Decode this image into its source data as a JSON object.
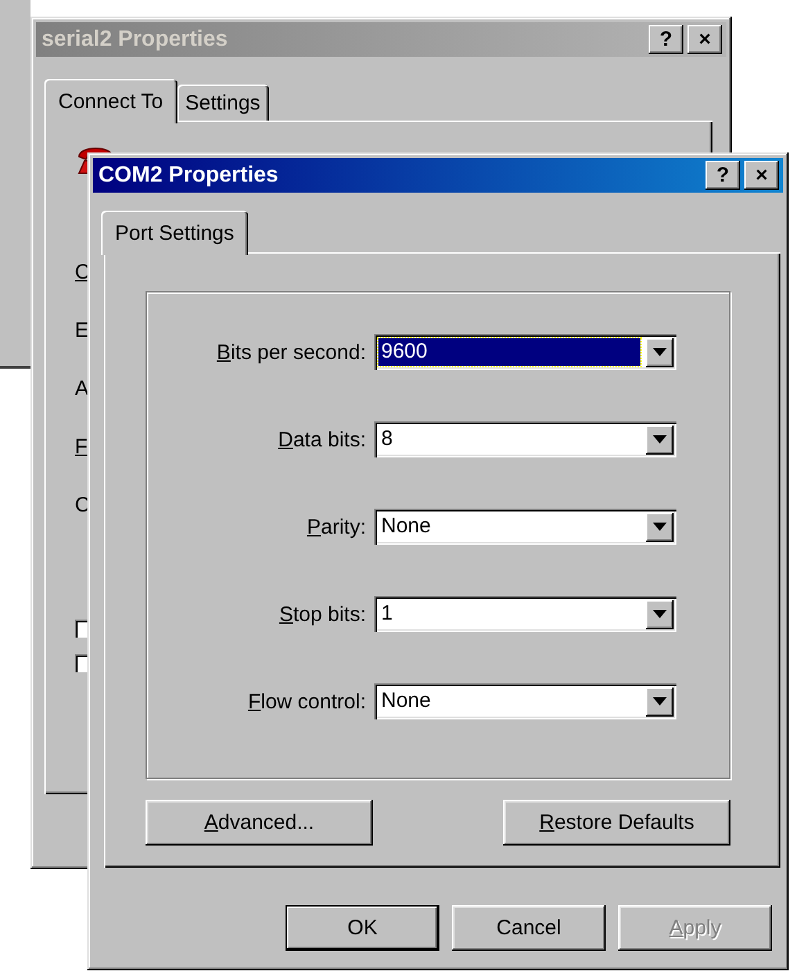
{
  "back_window": {
    "title": "serial2 Properties",
    "title_buttons": [
      "?",
      "×"
    ],
    "tabs": [
      {
        "label": "Connect To",
        "selected": true
      },
      {
        "label": "Settings",
        "selected": false
      }
    ],
    "cut_labels": [
      {
        "text": "C",
        "underlined_key": true
      },
      {
        "text": "E",
        "underlined_key": false
      },
      {
        "text": "A",
        "underlined_key": false
      },
      {
        "text": "F",
        "underlined_key": true
      },
      {
        "text": "C",
        "underlined_key": false
      }
    ],
    "cut_checkboxes": [
      {
        "checked": false
      },
      {
        "checked": false
      }
    ]
  },
  "window": {
    "title": "COM2 Properties",
    "title_buttons": [
      "?",
      "×"
    ],
    "tabs": [
      {
        "label": "Port Settings",
        "selected": true
      }
    ],
    "fields": [
      {
        "label": "Bits per second:",
        "value": "9600",
        "focused": true,
        "underlined_key": true
      },
      {
        "label": "Data bits:",
        "value": "8",
        "focused": false,
        "underlined_key": true
      },
      {
        "label": "Parity:",
        "value": "None",
        "focused": false,
        "underlined_key": true
      },
      {
        "label": "Stop bits:",
        "value": "1",
        "focused": false,
        "underlined_key": true
      },
      {
        "label": "Flow control:",
        "value": "None",
        "focused": false,
        "underlined_key": true
      }
    ],
    "panel_buttons": [
      {
        "label": "Advanced...",
        "underlined_key": true
      },
      {
        "label": "Restore Defaults",
        "underlined_key": true
      }
    ],
    "buttons": [
      {
        "label": "OK",
        "default": true,
        "disabled": false,
        "underlined_key": false
      },
      {
        "label": "Cancel",
        "default": false,
        "disabled": false,
        "underlined_key": false
      },
      {
        "label": "Apply",
        "default": false,
        "disabled": true,
        "underlined_key": true
      }
    ]
  }
}
